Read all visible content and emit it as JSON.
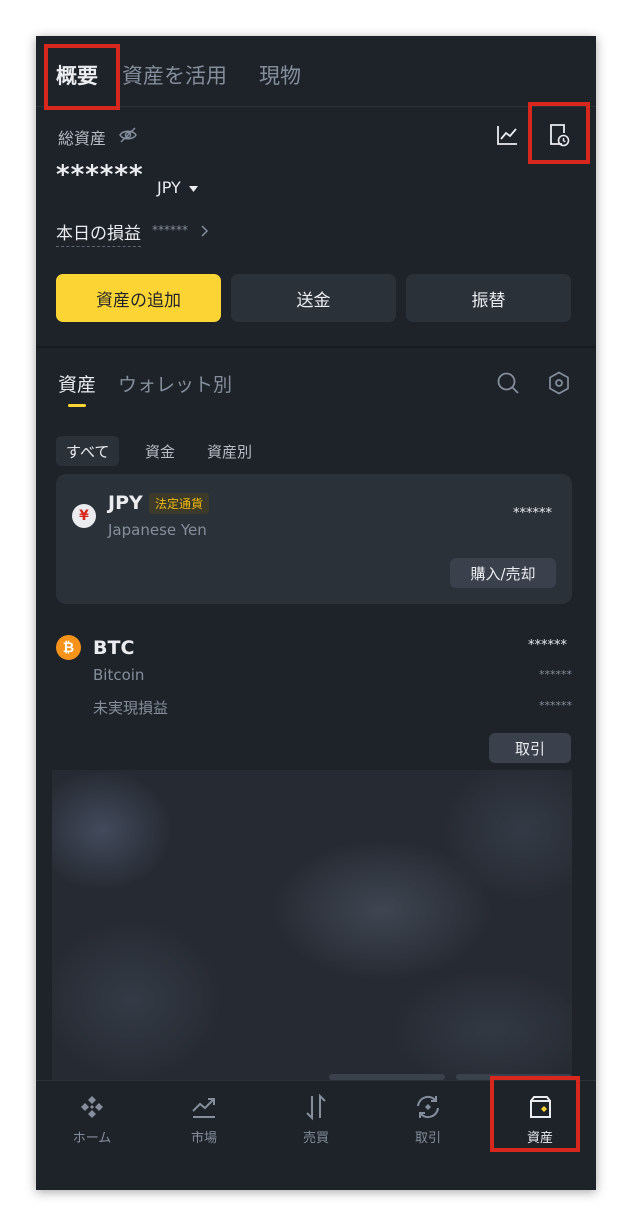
{
  "top_tabs": [
    {
      "label": "概要",
      "active": true
    },
    {
      "label": "資産を活用",
      "active": false
    },
    {
      "label": "現物",
      "active": false
    }
  ],
  "header": {
    "total_assets_label": "総資産",
    "hidden_balance": "******",
    "currency": "JPY",
    "daily_pnl_label": "本日の損益",
    "daily_pnl_value": "******"
  },
  "actions": {
    "add_assets": "資産の追加",
    "send": "送金",
    "transfer": "振替"
  },
  "asset_tabs": [
    {
      "label": "資産",
      "active": true
    },
    {
      "label": "ウォレット別",
      "active": false
    }
  ],
  "filters": [
    {
      "label": "すべて",
      "active": true
    },
    {
      "label": "資金",
      "active": false
    },
    {
      "label": "資産別",
      "active": false
    }
  ],
  "assets": {
    "jpy": {
      "symbol": "JPY",
      "badge": "法定通貨",
      "name": "Japanese Yen",
      "value": "******",
      "button": "購入/売却",
      "icon_glyph": "¥"
    },
    "btc": {
      "symbol": "BTC",
      "name": "Bitcoin",
      "value": "******",
      "sub_value": "******",
      "pnl_label": "未実現損益",
      "pnl_value": "******",
      "button": "取引",
      "icon_glyph": "₿"
    }
  },
  "bottom_nav": [
    {
      "label": "ホーム",
      "icon": "binance-logo-icon"
    },
    {
      "label": "市場",
      "icon": "market-chart-icon"
    },
    {
      "label": "売買",
      "icon": "trade-arrows-icon"
    },
    {
      "label": "取引",
      "icon": "futures-exchange-icon"
    },
    {
      "label": "資産",
      "icon": "wallet-icon",
      "active": true
    }
  ],
  "colors": {
    "background": "#1e2329",
    "brand_yellow": "#fcd535",
    "highlight_red": "#d8271c",
    "btc_orange": "#f7931a"
  }
}
